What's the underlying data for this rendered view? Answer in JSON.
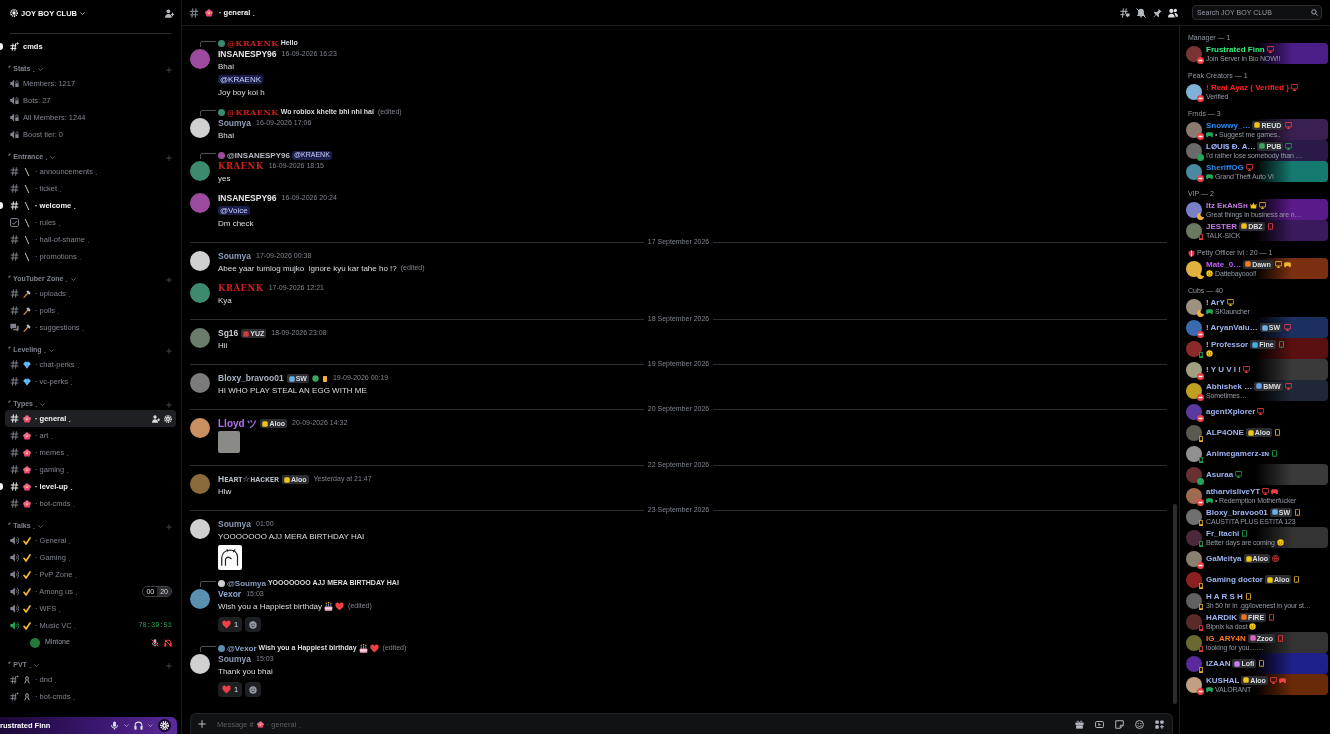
{
  "server": {
    "name": "JOY BOY CLUB"
  },
  "top_channels": [
    {
      "name": "cmds",
      "kind": "text-private",
      "unread": true,
      "selected": false
    }
  ],
  "categories": [
    {
      "name": "⌜ Stats ˏ",
      "kind": "none",
      "channels": [
        {
          "name": "Members: 1217",
          "kind": "stat",
          "unread": false,
          "selected": false
        },
        {
          "name": "Bots: 27",
          "kind": "stat",
          "unread": false,
          "selected": false
        },
        {
          "name": "All Members: 1244",
          "kind": "stat",
          "unread": false,
          "selected": false
        },
        {
          "name": "Boost tier: 0",
          "kind": "stat",
          "unread": false,
          "selected": false
        }
      ]
    },
    {
      "name": "⌜ Entrance ˏ",
      "kind": "blade",
      "channels": [
        {
          "name": "· announcements ˏ",
          "kind": "text",
          "unread": false,
          "selected": false
        },
        {
          "name": "· ticket ˏ",
          "kind": "text",
          "unread": false,
          "selected": false
        },
        {
          "name": "· welcome ˏ",
          "kind": "text",
          "unread": true,
          "selected": false
        },
        {
          "name": "· rules ˏ",
          "kind": "rules",
          "unread": false,
          "selected": false
        },
        {
          "name": "· hall-of-shame ˏ",
          "kind": "text",
          "unread": false,
          "selected": false
        },
        {
          "name": "· promotions ˏ",
          "kind": "text",
          "unread": false,
          "selected": false
        }
      ]
    },
    {
      "name": "⌜ YouTuber Zone ˏ",
      "kind": "hammer",
      "channels": [
        {
          "name": "· uploads ˏ",
          "kind": "text",
          "unread": false,
          "selected": false
        },
        {
          "name": "· polls ˏ",
          "kind": "text",
          "unread": false,
          "selected": false
        },
        {
          "name": "· suggestions ˏ",
          "kind": "forum",
          "unread": false,
          "selected": false
        }
      ]
    },
    {
      "name": "⌜ Leveling ˏ",
      "kind": "gem",
      "channels": [
        {
          "name": "· chat-perks ˏ",
          "kind": "text",
          "unread": false,
          "selected": false
        },
        {
          "name": "· vc-perks ˏ",
          "kind": "text",
          "unread": false,
          "selected": false
        }
      ]
    },
    {
      "name": "⌜ Types ˏ",
      "kind": "flower",
      "channels": [
        {
          "name": "· general ˏ",
          "kind": "text",
          "unread": false,
          "selected": true
        },
        {
          "name": "· art ˏ",
          "kind": "text",
          "unread": false,
          "selected": false
        },
        {
          "name": "· memes ˏ",
          "kind": "text",
          "unread": false,
          "selected": false
        },
        {
          "name": "· gaming ˏ",
          "kind": "text",
          "unread": false,
          "selected": false
        },
        {
          "name": "· level-up ˏ",
          "kind": "text",
          "unread": true,
          "selected": false
        },
        {
          "name": "· bot-cmds ˏ",
          "kind": "text",
          "unread": false,
          "selected": false
        }
      ]
    },
    {
      "name": "⌜ Talks ˏ",
      "kind": "check",
      "channels": [
        {
          "name": "· General ˏ",
          "kind": "voice",
          "active": false,
          "unread": false,
          "selected": false
        },
        {
          "name": "· Gaming ˏ",
          "kind": "voice",
          "active": false,
          "unread": false,
          "selected": false
        },
        {
          "name": "· PvP Zone ˏ",
          "kind": "voice",
          "active": false,
          "unread": false,
          "selected": false
        },
        {
          "name": "· Among us ˏ",
          "kind": "voice",
          "active": false,
          "unread": false,
          "selected": false,
          "limit": {
            "count": "00",
            "max": "20"
          }
        },
        {
          "name": "· WFS ˏ",
          "kind": "voice",
          "active": false,
          "unread": false,
          "selected": false
        },
        {
          "name": "· Music VC ˏ",
          "kind": "voice",
          "active": true,
          "unread": false,
          "selected": false,
          "timer": "78:39:51",
          "users": [
            {
              "name": "Mintone",
              "avatar": {
                "color": "#1f7a3c"
              },
              "muted": true,
              "deafened": true
            }
          ]
        }
      ]
    },
    {
      "name": "⌜ PVT ˏ",
      "kind": "ribbon",
      "channels": [
        {
          "name": "· dnd ˏ",
          "kind": "text-private",
          "unread": false,
          "selected": false
        },
        {
          "name": "· bot-cmds ˏ",
          "kind": "text-private",
          "unread": false,
          "selected": false
        }
      ]
    }
  ],
  "user_panel": {
    "name": "rustrated Finn"
  },
  "channel_header": {
    "kind": "flower",
    "name": "· general ˏ"
  },
  "search": {
    "placeholder": "Search JOY BOY CLUB"
  },
  "messages": [
    {
      "kind": "message",
      "author": "INSANESPY96",
      "color": "#e3e5e8",
      "stylized": false,
      "avatar": {
        "color": "#9c4c9e"
      },
      "time": "16-09-2026 16:23",
      "reply": {
        "avatar": {
          "color": "#3d8a6e"
        },
        "to": "@KRAENK",
        "color": "#c8201e",
        "stylized": true,
        "text": "Hello"
      },
      "lines": [
        {
          "kind": "text",
          "text": "Bhai"
        },
        {
          "kind": "mention",
          "text": "@KRAENK"
        },
        {
          "kind": "text",
          "text": "Joy boy koi h"
        }
      ]
    },
    {
      "kind": "message",
      "author": "Soumya",
      "color": "#8e9cb8",
      "stylized": false,
      "avatar": {
        "color": "#d0d0d0"
      },
      "time": "16-09-2026 17:06",
      "reply": {
        "avatar": {
          "color": "#3d8a6e"
        },
        "to": "@KRAENK",
        "color": "#c8201e",
        "stylized": true,
        "text": "Wo roblox khelte bhi nhi hai",
        "edited": "(edited)"
      },
      "lines": [
        {
          "kind": "text",
          "text": "Bhai"
        }
      ]
    },
    {
      "kind": "message",
      "author": "KRAENK",
      "color": "#d21f1f",
      "stylized": true,
      "avatar": {
        "color": "#3d8a6e"
      },
      "time": "16-09-2026 18:15",
      "reply": {
        "avatar": {
          "color": "#9c4c9e"
        },
        "to": "@INSANESPY96",
        "color": "#b5bac1",
        "stylized": false,
        "mention": "@KRAENK"
      },
      "lines": [
        {
          "kind": "text",
          "text": "yes"
        }
      ]
    },
    {
      "kind": "message",
      "author": "INSANESPY96",
      "color": "#e3e5e8",
      "stylized": false,
      "avatar": {
        "color": "#9c4c9e"
      },
      "time": "16-09-2026 20:24",
      "lines": [
        {
          "kind": "mention",
          "text": "@Voice"
        },
        {
          "kind": "text",
          "text": "Dm check"
        }
      ]
    },
    {
      "kind": "divider",
      "text": "17 September 2026"
    },
    {
      "kind": "message",
      "author": "Soumya",
      "color": "#8e9cb8",
      "stylized": false,
      "avatar": {
        "color": "#d0d0d0"
      },
      "time": "17-09-2026 00:38",
      "lines": [
        {
          "kind": "text",
          "text": "Abee yaar tumlog mujko  ignore kyu kar tahe ho !?",
          "edited": "(edited)"
        }
      ]
    },
    {
      "kind": "message",
      "author": "KRAENK",
      "color": "#d21f1f",
      "stylized": true,
      "avatar": {
        "color": "#3d8a6e"
      },
      "time": "17-09-2026 12:21",
      "lines": [
        {
          "kind": "text",
          "text": "Kya"
        }
      ]
    },
    {
      "kind": "divider",
      "text": "18 September 2026"
    },
    {
      "kind": "message",
      "author": "Sg16",
      "color": "#c4c9ce",
      "stylized": false,
      "avatar": {
        "color": "#6b7d6a"
      },
      "tag": {
        "label": "YUZ",
        "color": "#d03b3b"
      },
      "time": "18-09-2026 23:08",
      "lines": [
        {
          "kind": "text",
          "text": "Hii"
        }
      ]
    },
    {
      "kind": "divider",
      "text": "19 September 2026"
    },
    {
      "kind": "message",
      "author": "Bloxy_bravoo01",
      "color": "#a9b4c2",
      "stylized": false,
      "avatar": {
        "color": "#7a7a7a"
      },
      "tag": {
        "label": "SW",
        "color": "#6ab0e8"
      },
      "badges": [
        {
          "kind": "round",
          "color": "#3ba55c"
        },
        {
          "kind": "mobile",
          "color": "#f0b232"
        }
      ],
      "time": "19-09-2026 00:19",
      "lines": [
        {
          "kind": "text",
          "text": "HI WHO PLAY STEAL AN EGG WITH ME"
        }
      ]
    },
    {
      "kind": "divider",
      "text": "20 September 2026"
    },
    {
      "kind": "message",
      "author": "Lloyd ツ",
      "color": "#b26ef0",
      "stylized": false,
      "avatar": {
        "color": "#c89060"
      },
      "tag": {
        "label": "Aloo",
        "color": "#f0c419"
      },
      "time": "20-09-2026 14:32",
      "attachment": {
        "kind": "photo"
      }
    },
    {
      "kind": "divider",
      "text": "22 September 2026"
    },
    {
      "kind": "message",
      "author": "Hᴇᴀʀᴛ☆ʜᴀᴄᴋᴇʀ",
      "color": "#b5bac1",
      "stylized": false,
      "avatar": {
        "color": "#8a6a3a"
      },
      "tag": {
        "label": "Aloo",
        "color": "#f0c419"
      },
      "time": "Yesterday at 21:47",
      "lines": [
        {
          "kind": "text",
          "text": "Hlw"
        }
      ]
    },
    {
      "kind": "divider",
      "text": "23 September 2026"
    },
    {
      "kind": "message",
      "author": "Soumya",
      "color": "#8e9cb8",
      "stylized": false,
      "avatar": {
        "color": "#d0d0d0"
      },
      "time": "01:00",
      "lines": [
        {
          "kind": "text",
          "text": "YOOOOOOO AJJ MERA BIRTHDAY HAI"
        }
      ],
      "attachment": {
        "kind": "drawing"
      }
    },
    {
      "kind": "message",
      "author": "Vexor",
      "color": "#8ea6cf",
      "stylized": false,
      "avatar": {
        "color": "#5a8fb0"
      },
      "time": "15:03",
      "reply": {
        "avatar": {
          "color": "#d0d0d0"
        },
        "to": "@Soumya",
        "color": "#8e9cb8",
        "stylized": false,
        "text": "YOOOOOOO AJJ MERA BIRTHDAY HAI"
      },
      "lines": [
        {
          "kind": "text",
          "text": "Wish you a Happiest birthday",
          "emoji": [
            {
              "kind": "cake"
            },
            {
              "kind": "heart"
            }
          ],
          "edited": "(edited)"
        }
      ],
      "reactions": [
        {
          "kind": "heart",
          "count": "1"
        }
      ],
      "add_reaction": true
    },
    {
      "kind": "message",
      "author": "Soumya",
      "color": "#8e9cb8",
      "stylized": false,
      "avatar": {
        "color": "#d0d0d0"
      },
      "time": "15:03",
      "reply": {
        "avatar": {
          "color": "#5a8fb0"
        },
        "to": "@Vexor",
        "color": "#8ea6cf",
        "stylized": false,
        "text": "Wish you a Happiest birthday",
        "emoji": [
          {
            "kind": "cake"
          },
          {
            "kind": "heart"
          }
        ],
        "edited": "(edited)"
      },
      "lines": [
        {
          "kind": "text",
          "text": "Thank you bhai"
        }
      ],
      "reactions": [
        {
          "kind": "heart",
          "count": "1"
        }
      ],
      "add_reaction": true
    }
  ],
  "composer": {
    "placeholder": "Message #",
    "channel": "· general ˏ"
  },
  "member_groups": [
    {
      "title": "Manager — 1",
      "kind": "plain",
      "members": [
        {
          "name": "Frustrated Finn",
          "color": "#2ff07e",
          "avatar": {
            "color": "#7a3434"
          },
          "presence": {
            "kind": "dnd",
            "mobile": false
          },
          "platforms": [
            {
              "kind": "desktop"
            }
          ],
          "sub": "Join Server in Bio NOW!!",
          "nameplate": {
            "color": "#4b1d86"
          }
        }
      ]
    },
    {
      "title": "Peak Creators — 1",
      "kind": "plain",
      "members": [
        {
          "name": "! Real Ayaz ( Verified )",
          "color": "#ff2020",
          "avatar": {
            "color": "#7fb0d8"
          },
          "presence": {
            "kind": "dnd",
            "mobile": false
          },
          "platforms": [
            {
              "kind": "desktop"
            }
          ],
          "sub": "Verified"
        }
      ]
    },
    {
      "title": "Frnds — 3",
      "kind": "plain",
      "members": [
        {
          "name": "Snowwy_…",
          "color": "#2a8cf0",
          "avatar": {
            "color": "#8a7a70"
          },
          "presence": {
            "kind": "dnd",
            "mobile": false
          },
          "tag": {
            "label": "REUD",
            "color": "#f0c020"
          },
          "platforms": [
            {
              "kind": "desktop"
            }
          ],
          "activity": {
            "kind": "game"
          },
          "sub": "• Suggest me games..",
          "nameplate": {
            "color": "#3a2050"
          }
        },
        {
          "name": "LØUI$ Ð. A…",
          "color": "#9fb4ff",
          "avatar": {
            "color": "#6a6a6a"
          },
          "presence": {
            "kind": "online",
            "mobile": false
          },
          "tag": {
            "label": "PUB",
            "color": "#3ba55c"
          },
          "platforms": [
            {
              "kind": "desktop"
            }
          ],
          "sub": "I'd rather lose somebody than …",
          "nameplate": {
            "color": "#2a1a48"
          }
        },
        {
          "name": "SheriffOG",
          "color": "#2a8cf0",
          "avatar": {
            "color": "#4a8aa0"
          },
          "presence": {
            "kind": "dnd",
            "mobile": false
          },
          "platforms": [
            {
              "kind": "desktop"
            }
          ],
          "activity": {
            "kind": "game"
          },
          "sub": "Grand Theft Auto VI",
          "nameplate": {
            "color": "#147a70"
          }
        }
      ]
    },
    {
      "title": "VIP — 2",
      "kind": "plain",
      "members": [
        {
          "name": "Itz EᴋAɴSʜ",
          "color": "#c27ae0",
          "avatar": {
            "color": "#7a80c8"
          },
          "presence": {
            "kind": "idle",
            "mobile": false
          },
          "crown": true,
          "platforms": [
            {
              "kind": "desktop"
            }
          ],
          "sub": "Great things in business are n…",
          "nameplate": {
            "color": "#5a1a8a"
          }
        },
        {
          "name": "JESTER",
          "color": "#c27ae0",
          "avatar": {
            "color": "#6a7a60"
          },
          "presence": {
            "kind": "dnd",
            "mobile": true
          },
          "tag": {
            "label": "DBZ",
            "color": "#f0c020"
          },
          "platforms": [
            {
              "kind": "mobile"
            }
          ],
          "sub": "TALK-SICK",
          "nameplate": {
            "color": "#3a1a5a"
          }
        }
      ]
    },
    {
      "title": "Petty Officer lvl : 20 — 1",
      "kind": "shield",
      "members": [
        {
          "name": "Mate_0…",
          "color": "#c060ff",
          "avatar": {
            "color": "#e0b040"
          },
          "presence": {
            "kind": "idle",
            "mobile": false
          },
          "tag": {
            "label": "Dawn",
            "color": "#f08020"
          },
          "platforms": [
            {
              "kind": "desktop"
            },
            {
              "kind": "game"
            }
          ],
          "activity": {
            "kind": "emoji"
          },
          "sub": "Dattebayooo!!",
          "nameplate": {
            "color": "#7a3010"
          }
        }
      ]
    },
    {
      "title": "Cubs — 40",
      "kind": "plain",
      "members": [
        {
          "name": "! ArY",
          "color": "#9db4f0",
          "avatar": {
            "color": "#a09080"
          },
          "presence": {
            "kind": "idle",
            "mobile": false
          },
          "platforms": [
            {
              "kind": "desktop"
            }
          ],
          "activity": {
            "kind": "game"
          },
          "sub": "SKlauncher"
        },
        {
          "name": "! AryanValu…",
          "color": "#9db4f0",
          "avatar": {
            "color": "#3a6ab0"
          },
          "presence": {
            "kind": "dnd",
            "mobile": false
          },
          "tag": {
            "label": "SW",
            "color": "#6ab0e8"
          },
          "platforms": [
            {
              "kind": "desktop"
            }
          ],
          "nameplate": {
            "color": "#1c3060"
          }
        },
        {
          "name": "! Professor",
          "color": "#9db4f0",
          "avatar": {
            "color": "#8a2a2a"
          },
          "presence": {
            "kind": "online",
            "mobile": true
          },
          "tag": {
            "label": "Fine",
            "color": "#40b0e0"
          },
          "platforms": [
            {
              "kind": "mobile"
            }
          ],
          "activity": {
            "kind": "emoji"
          },
          "nameplate": {
            "color": "#5a1010"
          }
        },
        {
          "name": "! Y U V I !",
          "color": "#9db4f0",
          "avatar": {
            "color": "#a0a080"
          },
          "presence": {
            "kind": "dnd",
            "mobile": false
          },
          "platforms": [
            {
              "kind": "desktop"
            }
          ],
          "nameplate": {
            "color": "#3a3a3a"
          }
        },
        {
          "name": "Abhishek …",
          "color": "#9db4f0",
          "avatar": {
            "color": "#c0a020"
          },
          "presence": {
            "kind": "dnd",
            "mobile": false
          },
          "tag": {
            "label": "BMW",
            "color": "#60a0e0"
          },
          "platforms": [
            {
              "kind": "desktop"
            }
          ],
          "sub": "Sometimes…",
          "nameplate": {
            "color": "#202838"
          }
        },
        {
          "name": "agentXplorer",
          "color": "#9db4f0",
          "avatar": {
            "color": "#5a3aa0"
          },
          "presence": {
            "kind": "dnd",
            "mobile": false
          },
          "platforms": [
            {
              "kind": "desktop"
            }
          ]
        },
        {
          "name": "ALP4ONE",
          "color": "#9db4f0",
          "avatar": {
            "color": "#5a5a50"
          },
          "presence": {
            "kind": "idle",
            "mobile": true
          },
          "tag": {
            "label": "Aloo",
            "color": "#f0c419"
          },
          "platforms": [
            {
              "kind": "mobile"
            }
          ]
        },
        {
          "name": "Animegamerz-ɪɴ",
          "color": "#9db4f0",
          "avatar": {
            "color": "#909090"
          },
          "presence": {
            "kind": "online",
            "mobile": true
          },
          "platforms": [
            {
              "kind": "mobile"
            }
          ]
        },
        {
          "name": "Asuraa",
          "color": "#9db4f0",
          "avatar": {
            "color": "#6a3030"
          },
          "presence": {
            "kind": "online",
            "mobile": false
          },
          "platforms": [
            {
              "kind": "desktop"
            }
          ],
          "nameplate": {
            "color": "#3a3a3a"
          }
        },
        {
          "name": "atharvisliveYT",
          "color": "#9db4f0",
          "avatar": {
            "color": "#a06a50"
          },
          "presence": {
            "kind": "dnd",
            "mobile": false
          },
          "platforms": [
            {
              "kind": "desktop"
            },
            {
              "kind": "game"
            }
          ],
          "activity": {
            "kind": "game"
          },
          "sub": "• Redemption Motherfucker"
        },
        {
          "name": "Bloxy_bravoo01",
          "color": "#9db4f0",
          "avatar": {
            "color": "#707070"
          },
          "presence": {
            "kind": "idle",
            "mobile": true
          },
          "tag": {
            "label": "SW",
            "color": "#6ab0e8"
          },
          "platforms": [
            {
              "kind": "mobile"
            }
          ],
          "sub": "CAUSTITA PLUS ESTITA 123"
        },
        {
          "name": "Fr_Itachi",
          "color": "#9db4f0",
          "avatar": {
            "color": "#4a2a3a"
          },
          "presence": {
            "kind": "online",
            "mobile": true
          },
          "platforms": [
            {
              "kind": "mobile"
            }
          ],
          "sub": "Better days are coming",
          "end_emoji": true,
          "nameplate": {
            "color": "#333333"
          }
        },
        {
          "name": "GaMeitya",
          "color": "#9db4f0",
          "avatar": {
            "color": "#8a8070"
          },
          "presence": {
            "kind": "dnd",
            "mobile": false
          },
          "tag": {
            "label": "Aloo",
            "color": "#f0c419"
          },
          "platforms": [
            {
              "kind": "web"
            }
          ]
        },
        {
          "name": "Gaming doctor",
          "color": "#9db4f0",
          "avatar": {
            "color": "#8a2020"
          },
          "presence": {
            "kind": "idle",
            "mobile": true
          },
          "tag": {
            "label": "Aloo",
            "color": "#f0c419"
          },
          "platforms": [
            {
              "kind": "mobile"
            }
          ]
        },
        {
          "name": "H A R S H",
          "color": "#9db4f0",
          "avatar": {
            "color": "#606060"
          },
          "presence": {
            "kind": "idle",
            "mobile": true
          },
          "platforms": [
            {
              "kind": "mobile"
            }
          ],
          "sub": "3h 50 hr in .gg/lovenest in your st…"
        },
        {
          "name": "HARDIK",
          "color": "#9db4f0",
          "avatar": {
            "color": "#5a2a2a"
          },
          "presence": {
            "kind": "dnd",
            "mobile": true
          },
          "tag": {
            "label": "FIRE",
            "color": "#f07020"
          },
          "platforms": [
            {
              "kind": "mobile"
            }
          ],
          "sub": "Bipnix ka dost",
          "end_emoji": true
        },
        {
          "name": "IG_ARY4N",
          "color": "#ff7a20",
          "avatar": {
            "color": "#6a6a30"
          },
          "presence": {
            "kind": "dnd",
            "mobile": true
          },
          "tag": {
            "label": "Zᴢoo",
            "color": "#e060c0"
          },
          "platforms": [
            {
              "kind": "mobile"
            }
          ],
          "sub": "looking for you........",
          "nameplate": {
            "color": "#333333"
          }
        },
        {
          "name": "IZAAN",
          "color": "#9db4f0",
          "avatar": {
            "color": "#5a2a9a"
          },
          "presence": {
            "kind": "idle",
            "mobile": true
          },
          "tag": {
            "label": "Lofi",
            "color": "#c080f0"
          },
          "platforms": [
            {
              "kind": "mobile"
            }
          ],
          "nameplate": {
            "color": "#20208a"
          }
        },
        {
          "name": "KUSHAL",
          "color": "#9db4f0",
          "avatar": {
            "color": "#c0a080"
          },
          "presence": {
            "kind": "dnd",
            "mobile": false
          },
          "tag": {
            "label": "Aloo",
            "color": "#f0c419"
          },
          "platforms": [
            {
              "kind": "desktop"
            },
            {
              "kind": "game"
            }
          ],
          "activity": {
            "kind": "game"
          },
          "sub": "VALORANT",
          "nameplate": {
            "color": "#6a2a08"
          }
        }
      ]
    }
  ]
}
